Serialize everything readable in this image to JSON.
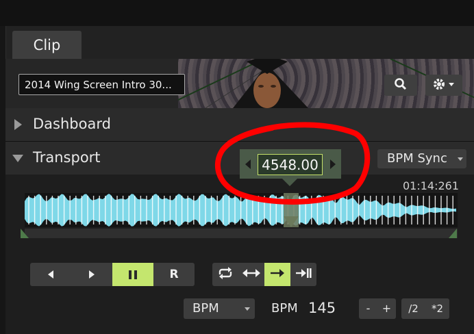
{
  "tab": {
    "label": "Clip"
  },
  "clip": {
    "name": "2014 Wing Screen Intro 30..."
  },
  "sections": {
    "dashboard": "Dashboard",
    "transport": "Transport"
  },
  "transport": {
    "position_value": "4548.00",
    "sync_mode": "BPM Sync",
    "timecode": "01:14:261",
    "play_buttons": [
      "◀",
      "▶",
      "❚❚",
      "R"
    ],
    "mode_buttons": [
      "loop",
      "bounce",
      "play-once",
      "play-once-hold"
    ],
    "tempo_select": "BPM",
    "tempo_label": "BPM",
    "tempo_value": "145",
    "minus": "-",
    "plus": "+",
    "half": "/2",
    "double": "*2"
  },
  "colors": {
    "accent": "#c4e66e",
    "waveform": "#7fd8e8",
    "annotation": "#ff0000"
  }
}
